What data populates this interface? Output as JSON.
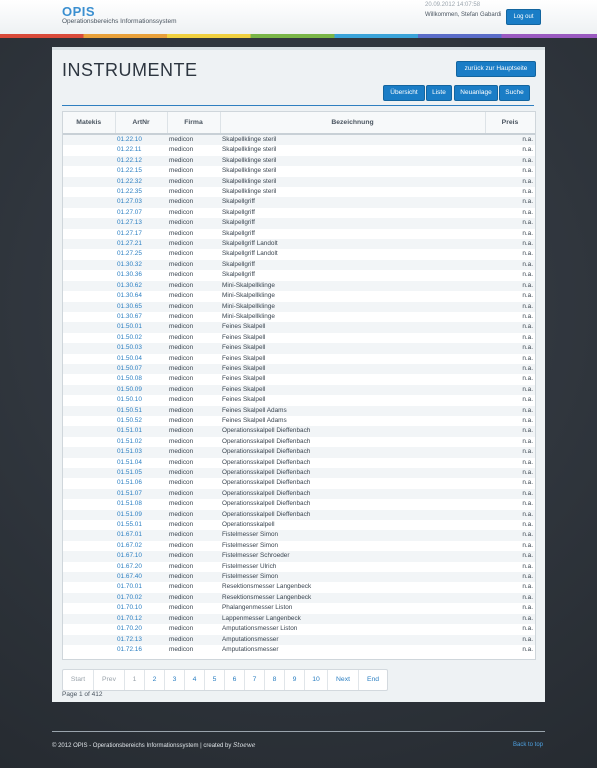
{
  "header": {
    "logo_title": "OPIS",
    "logo_subtitle": "Operationsbereichs Informationssystem",
    "datetime": "20.09.2012 14:07:58",
    "welcome": "Willkommen, Stefan Gabardi",
    "logout_label": "Log out"
  },
  "page": {
    "title": "INSTRUMENTE",
    "back_button": "zurück zur Hauptseite",
    "tabs": {
      "uebersicht": "Übersicht",
      "liste": "Liste",
      "neuanlage": "Neuanlage",
      "suche": "Suche"
    }
  },
  "table": {
    "columns": [
      "Matekis",
      "ArtNr",
      "Firma",
      "Bezeichnung",
      "Preis"
    ],
    "rows": [
      [
        "",
        "01.22.10",
        "medicon",
        "Skalpellklinge steril",
        "n.a."
      ],
      [
        "",
        "01.22.11",
        "medicon",
        "Skalpellklinge steril",
        "n.a."
      ],
      [
        "",
        "01.22.12",
        "medicon",
        "Skalpellklinge steril",
        "n.a."
      ],
      [
        "",
        "01.22.15",
        "medicon",
        "Skalpellklinge steril",
        "n.a."
      ],
      [
        "",
        "01.22.32",
        "medicon",
        "Skalpellklinge steril",
        "n.a."
      ],
      [
        "",
        "01.22.35",
        "medicon",
        "Skalpellklinge steril",
        "n.a."
      ],
      [
        "",
        "01.27.03",
        "medicon",
        "Skalpellgriff",
        "n.a."
      ],
      [
        "",
        "01.27.07",
        "medicon",
        "Skalpellgriff",
        "n.a."
      ],
      [
        "",
        "01.27.13",
        "medicon",
        "Skalpellgriff",
        "n.a."
      ],
      [
        "",
        "01.27.17",
        "medicon",
        "Skalpellgriff",
        "n.a."
      ],
      [
        "",
        "01.27.21",
        "medicon",
        "Skalpellgriff Landolt",
        "n.a."
      ],
      [
        "",
        "01.27.25",
        "medicon",
        "Skalpellgriff Landolt",
        "n.a."
      ],
      [
        "",
        "01.30.32",
        "medicon",
        "Skalpellgriff",
        "n.a."
      ],
      [
        "",
        "01.30.36",
        "medicon",
        "Skalpellgriff",
        "n.a."
      ],
      [
        "",
        "01.30.62",
        "medicon",
        "Mini-Skalpellklinge",
        "n.a."
      ],
      [
        "",
        "01.30.64",
        "medicon",
        "Mini-Skalpellklinge",
        "n.a."
      ],
      [
        "",
        "01.30.65",
        "medicon",
        "Mini-Skalpellklinge",
        "n.a."
      ],
      [
        "",
        "01.30.67",
        "medicon",
        "Mini-Skalpellklinge",
        "n.a."
      ],
      [
        "",
        "01.50.01",
        "medicon",
        "Feines Skalpell",
        "n.a."
      ],
      [
        "",
        "01.50.02",
        "medicon",
        "Feines Skalpell",
        "n.a."
      ],
      [
        "",
        "01.50.03",
        "medicon",
        "Feines Skalpell",
        "n.a."
      ],
      [
        "",
        "01.50.04",
        "medicon",
        "Feines Skalpell",
        "n.a."
      ],
      [
        "",
        "01.50.07",
        "medicon",
        "Feines Skalpell",
        "n.a."
      ],
      [
        "",
        "01.50.08",
        "medicon",
        "Feines Skalpell",
        "n.a."
      ],
      [
        "",
        "01.50.09",
        "medicon",
        "Feines Skalpell",
        "n.a."
      ],
      [
        "",
        "01.50.10",
        "medicon",
        "Feines Skalpell",
        "n.a."
      ],
      [
        "",
        "01.50.51",
        "medicon",
        "Feines Skalpell Adams",
        "n.a."
      ],
      [
        "",
        "01.50.52",
        "medicon",
        "Feines Skalpell Adams",
        "n.a."
      ],
      [
        "",
        "01.51.01",
        "medicon",
        "Operationsskalpell Dieffenbach",
        "n.a."
      ],
      [
        "",
        "01.51.02",
        "medicon",
        "Operationsskalpell Dieffenbach",
        "n.a."
      ],
      [
        "",
        "01.51.03",
        "medicon",
        "Operationsskalpell Dieffenbach",
        "n.a."
      ],
      [
        "",
        "01.51.04",
        "medicon",
        "Operationsskalpell Dieffenbach",
        "n.a."
      ],
      [
        "",
        "01.51.05",
        "medicon",
        "Operationsskalpell Dieffenbach",
        "n.a."
      ],
      [
        "",
        "01.51.06",
        "medicon",
        "Operationsskalpell Dieffenbach",
        "n.a."
      ],
      [
        "",
        "01.51.07",
        "medicon",
        "Operationsskalpell Dieffenbach",
        "n.a."
      ],
      [
        "",
        "01.51.08",
        "medicon",
        "Operationsskalpell Dieffenbach",
        "n.a."
      ],
      [
        "",
        "01.51.09",
        "medicon",
        "Operationsskalpell Dieffenbach",
        "n.a."
      ],
      [
        "",
        "01.55.01",
        "medicon",
        "Operationsskalpell",
        "n.a."
      ],
      [
        "",
        "01.67.01",
        "medicon",
        "Fistelmesser Simon",
        "n.a."
      ],
      [
        "",
        "01.67.02",
        "medicon",
        "Fistelmesser Simon",
        "n.a."
      ],
      [
        "",
        "01.67.10",
        "medicon",
        "Fistelmesser Schroeder",
        "n.a."
      ],
      [
        "",
        "01.67.20",
        "medicon",
        "Fistelmesser Ulrich",
        "n.a."
      ],
      [
        "",
        "01.67.40",
        "medicon",
        "Fistelmesser Simon",
        "n.a."
      ],
      [
        "",
        "01.70.01",
        "medicon",
        "Resektionsmesser Langenbeck",
        "n.a."
      ],
      [
        "",
        "01.70.02",
        "medicon",
        "Resektionsmesser Langenbeck",
        "n.a."
      ],
      [
        "",
        "01.70.10",
        "medicon",
        "Phalangenmesser Liston",
        "n.a."
      ],
      [
        "",
        "01.70.12",
        "medicon",
        "Lappenmesser Langenbeck",
        "n.a."
      ],
      [
        "",
        "01.70.20",
        "medicon",
        "Amputationsmesser Liston",
        "n.a."
      ],
      [
        "",
        "01.72.13",
        "medicon",
        "Amputationsmesser",
        "n.a."
      ],
      [
        "",
        "01.72.16",
        "medicon",
        "Amputationsmesser",
        "n.a."
      ]
    ]
  },
  "pagination": {
    "start": "Start",
    "prev": "Prev",
    "pages": [
      "1",
      "2",
      "3",
      "4",
      "5",
      "6",
      "7",
      "8",
      "9",
      "10"
    ],
    "next": "Next",
    "end": "End",
    "info": "Page 1 of 412"
  },
  "footer": {
    "copyright": "© 2012 OPIS - Operationsbereichs Informationssystem | created by",
    "signature": "Stoewe",
    "back_to_top": "Back to top"
  }
}
